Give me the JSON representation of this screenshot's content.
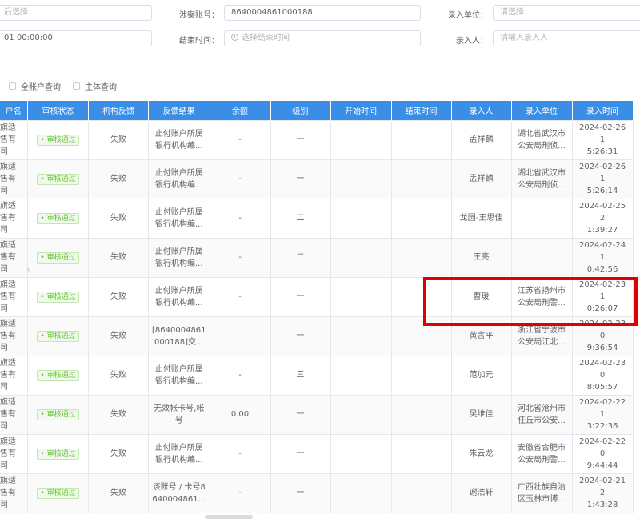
{
  "filters": {
    "row1_left_placeholder": "后选择",
    "account_label": "涉案账号：",
    "account_value": "8640004861000188",
    "unit_label": "录入单位：",
    "unit_placeholder": "请选择",
    "row2_left_value": "01 00:00:00",
    "end_time_label": "结束时间：",
    "end_time_placeholder": "选择结束时间",
    "entrant_label": "录入人：",
    "entrant_placeholder": "请输入录入人"
  },
  "options": {
    "all_accounts": "全账户查询",
    "subject_query": "主体查询"
  },
  "table": {
    "headers": [
      "户名",
      "审核状态",
      "机构反馈",
      "反馈结果",
      "余额",
      "级别",
      "开始时间",
      "结束时间",
      "录入人",
      "录入单位",
      "录入时间"
    ],
    "rows": [
      {
        "name": "节旗适\n销售有\n公司",
        "status": "审核通过",
        "feedback": "失败",
        "result": "止付账户所属\n银行机构编...",
        "balance": "-",
        "level": "一",
        "start": "",
        "end": "",
        "entrant": "孟祥麟",
        "unit": "湖北省武汉市\n公安局刑侦...",
        "time": "2024-02-26 1\n5:26:31"
      },
      {
        "name": "节旗适\n销售有\n公司",
        "status": "审核通过",
        "feedback": "失败",
        "result": "止付账户所属\n银行机构编...",
        "balance": "-",
        "level": "一",
        "start": "",
        "end": "",
        "entrant": "孟祥麟",
        "unit": "湖北省武汉市\n公安局刑侦...",
        "time": "2024-02-26 1\n5:26:14"
      },
      {
        "name": "节旗适\n销售有\n公司",
        "status": "审核通过",
        "feedback": "失败",
        "result": "止付账户所属\n银行机构编...",
        "balance": "-",
        "level": "二",
        "start": "",
        "end": "",
        "entrant": "龙圆-王思佳",
        "unit": "",
        "time": "2024-02-25 2\n1:39:27"
      },
      {
        "name": "节旗适\n销售有\n公司",
        "status": "审核通过",
        "feedback": "失败",
        "result": "止付账户所属\n银行机构编...",
        "balance": "-",
        "level": "二",
        "start": "",
        "end": "",
        "entrant": "王亮",
        "unit": "",
        "time": "2024-02-24 1\n0:42:56"
      },
      {
        "name": "节旗适\n销售有\n公司",
        "status": "审核通过",
        "feedback": "失败",
        "result": "止付账户所属\n银行机构编...",
        "balance": "-",
        "level": "一",
        "start": "",
        "end": "",
        "entrant": "曹瑗",
        "unit": "江苏省扬州市\n公安局刑警...",
        "time": "2024-02-23 1\n0:26:07"
      },
      {
        "name": "节旗适\n销售有\n公司",
        "status": "审核通过",
        "feedback": "失败",
        "result": "[8640004861\n000188]交...",
        "balance": "",
        "level": "一",
        "start": "",
        "end": "",
        "entrant": "黄言平",
        "unit": "浙江省宁波市\n公安局江北...",
        "time": "2024-02-23 0\n9:36:54"
      },
      {
        "name": "节旗适\n销售有\n公司",
        "status": "审核通过",
        "feedback": "失败",
        "result": "止付账户所属\n银行机构编...",
        "balance": "-",
        "level": "三",
        "start": "",
        "end": "",
        "entrant": "范加元",
        "unit": "",
        "time": "2024-02-23 0\n8:05:57"
      },
      {
        "name": "节旗适\n销售有\n公司",
        "status": "审核通过",
        "feedback": "失败",
        "result": "无效帐卡号,帐\n号",
        "balance": "0.00",
        "level": "一",
        "start": "",
        "end": "",
        "entrant": "吴维佳",
        "unit": "河北省沧州市\n任丘市公安...",
        "time": "2024-02-22 1\n3:22:36"
      },
      {
        "name": "节旗适\n销售有\n公司",
        "status": "审核通过",
        "feedback": "失败",
        "result": "止付账户所属\n银行机构编...",
        "balance": "-",
        "level": "一",
        "start": "",
        "end": "",
        "entrant": "朱云龙",
        "unit": "安徽省合肥市\n公安局刑警...",
        "time": "2024-02-22 0\n9:44:44"
      },
      {
        "name": "节旗适\n销售有\n公司",
        "status": "审核通过",
        "feedback": "失败",
        "result": "该账号 / 卡号8\n640004861...",
        "balance": "-",
        "level": "一",
        "start": "",
        "end": "",
        "entrant": "谢浩轩",
        "unit": "广西壮族自治\n区玉林市博...",
        "time": "2024-02-21 2\n1:43:28"
      }
    ]
  },
  "colors": {
    "header_bg": "#3a8ee6",
    "tag_green": "#67c23a",
    "highlight_red": "#e00000"
  }
}
